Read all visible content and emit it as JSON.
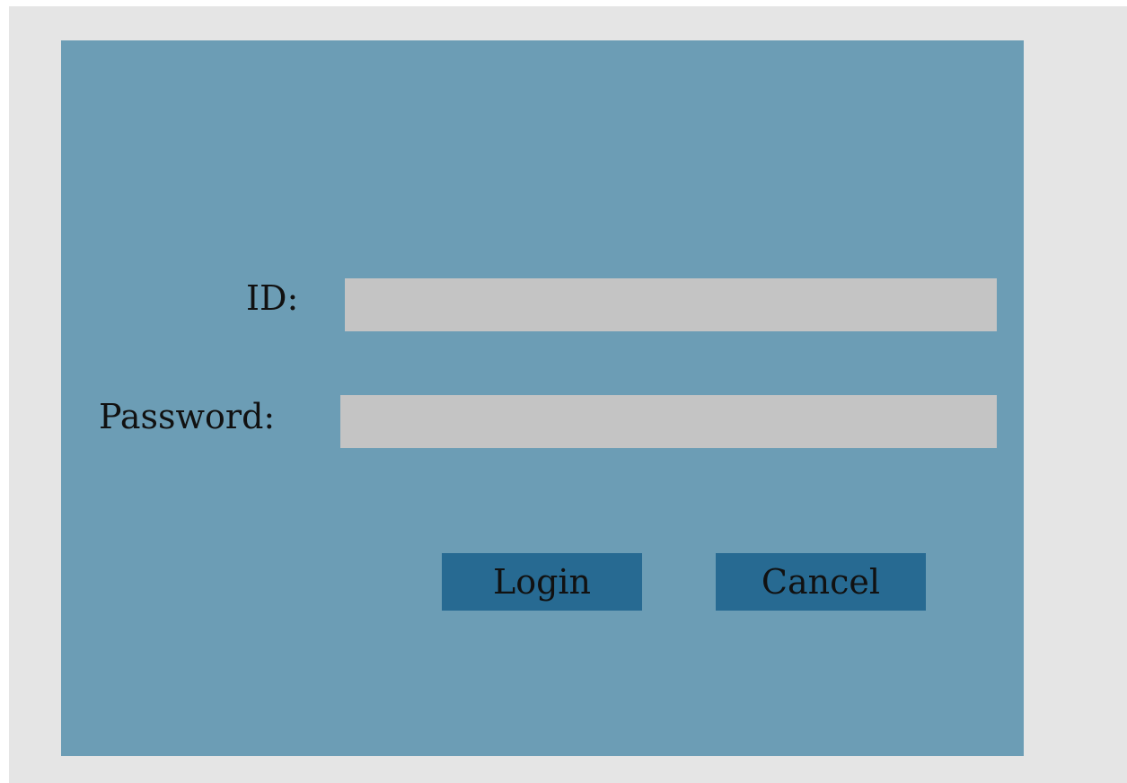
{
  "form": {
    "id_label": "ID:",
    "id_value": "",
    "password_label": "Password:",
    "password_value": ""
  },
  "buttons": {
    "login_label": "Login",
    "cancel_label": "Cancel"
  },
  "colors": {
    "outer_background": "#e5e5e5",
    "panel_background": "#6c9db5",
    "field_background": "#c4c4c4",
    "button_background": "#276a92",
    "text": "#111111"
  }
}
